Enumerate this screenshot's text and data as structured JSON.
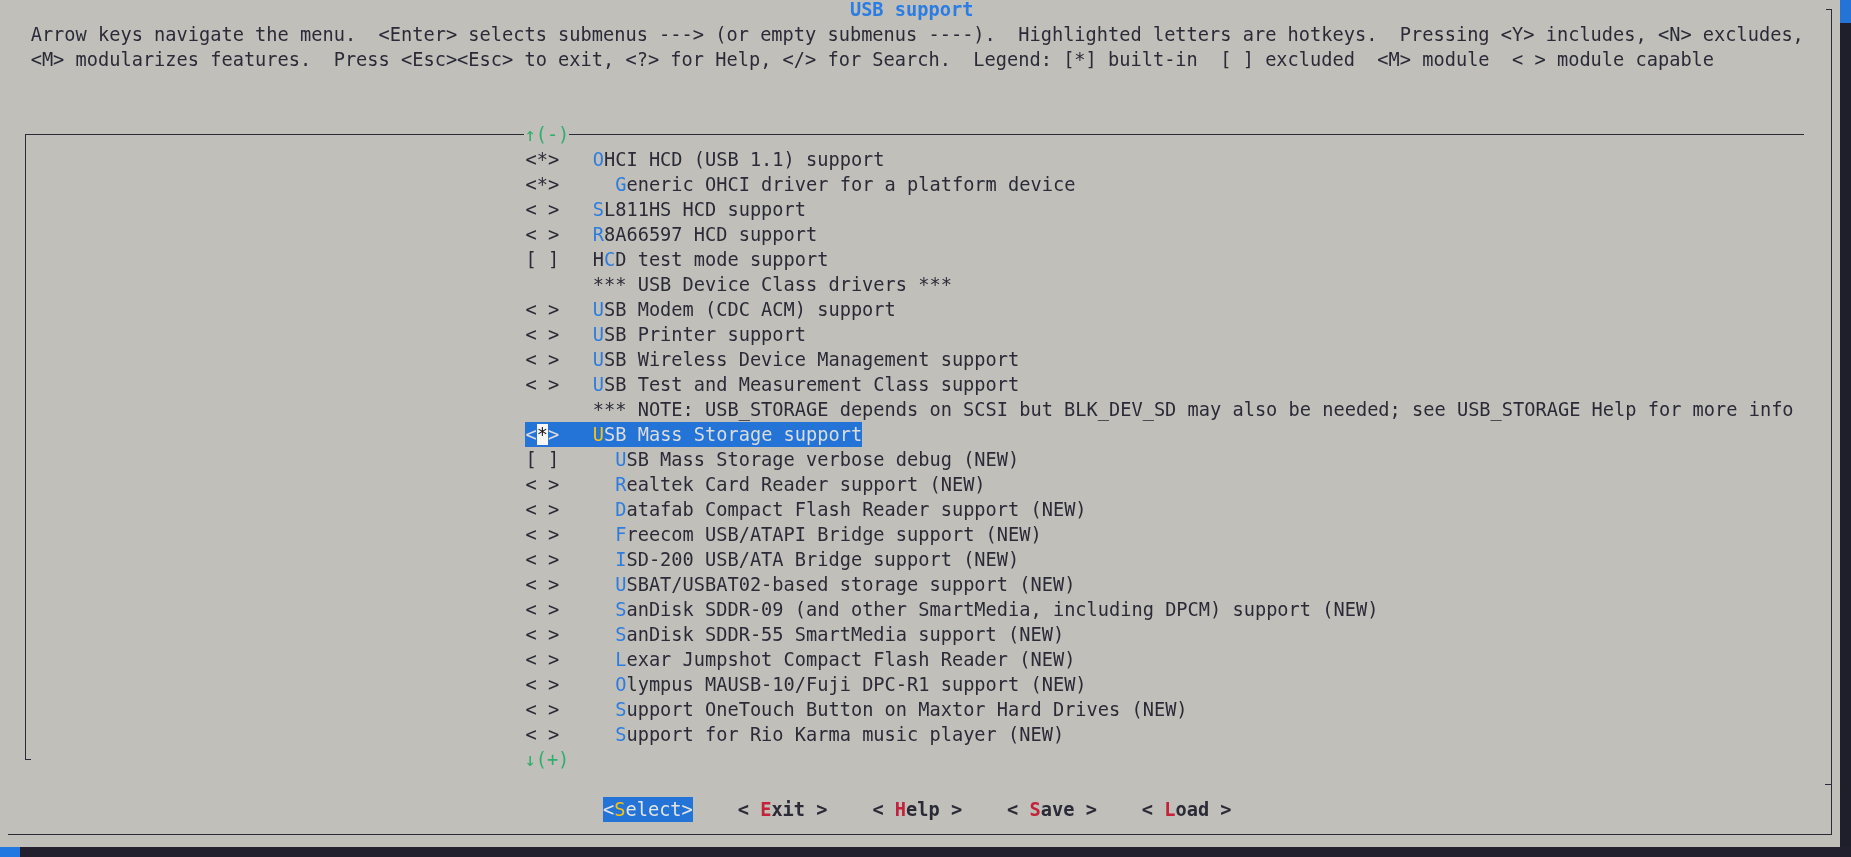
{
  "dialog": {
    "title": "USB support",
    "help_lines": [
      "Arrow keys navigate the menu.  <Enter> selects submenus ---> (or empty submenus ----).  Highlighted letters are hotkeys.  Pressing <Y> includes, <N> excludes,",
      "<M> modularizes features.  Press <Esc><Esc> to exit, <?> for Help, </> for Search.  Legend: [*] built-in  [ ] excluded  <M> module  < > module capable"
    ]
  },
  "menu": {
    "scroll_up": "↑(-)",
    "items": [
      {
        "kind": "option",
        "prompt": "<*>",
        "hotkey": "O",
        "after": "HCI HCD (USB 1.1) support",
        "selected": false,
        "children": [
          {
            "kind": "option",
            "prompt": "<*>",
            "hotkey": "G",
            "after": "eneric OHCI driver for a platform device",
            "selected": false
          }
        ]
      },
      {
        "kind": "option",
        "prompt": "< >",
        "hotkey": "S",
        "after": "L811HS HCD support",
        "selected": false
      },
      {
        "kind": "option",
        "prompt": "< >",
        "hotkey": "R",
        "after": "8A66597 HCD support",
        "selected": false
      },
      {
        "kind": "option",
        "prompt": "[ ]",
        "before": "H",
        "hotkey": "C",
        "after": "D test mode support",
        "selected": false
      },
      {
        "kind": "comment",
        "text": "*** USB Device Class drivers ***",
        "selected": false
      },
      {
        "kind": "option",
        "prompt": "< >",
        "hotkey": "U",
        "after": "SB Modem (CDC ACM) support",
        "selected": false
      },
      {
        "kind": "option",
        "prompt": "< >",
        "hotkey": "U",
        "after": "SB Printer support",
        "selected": false
      },
      {
        "kind": "option",
        "prompt": "< >",
        "hotkey": "U",
        "after": "SB Wireless Device Management support",
        "selected": false
      },
      {
        "kind": "option",
        "prompt": "< >",
        "hotkey": "U",
        "after": "SB Test and Measurement Class support",
        "selected": false
      },
      {
        "kind": "comment",
        "text": "*** NOTE: USB_STORAGE depends on SCSI but BLK_DEV_SD may also be needed; see USB_STORAGE Help for more info",
        "selected": false
      },
      {
        "kind": "option",
        "prompt": "<*>",
        "hotkey": "U",
        "after": "SB Mass Storage support",
        "selected": true,
        "children": [
          {
            "kind": "option",
            "prompt": "[ ]",
            "hotkey": "U",
            "after": "SB Mass Storage verbose debug (NEW)",
            "selected": false
          },
          {
            "kind": "option",
            "prompt": "< >",
            "hotkey": "R",
            "after": "ealtek Card Reader support (NEW)",
            "selected": false
          },
          {
            "kind": "option",
            "prompt": "< >",
            "hotkey": "D",
            "after": "atafab Compact Flash Reader support (NEW)",
            "selected": false
          },
          {
            "kind": "option",
            "prompt": "< >",
            "hotkey": "F",
            "after": "reecom USB/ATAPI Bridge support (NEW)",
            "selected": false
          },
          {
            "kind": "option",
            "prompt": "< >",
            "hotkey": "I",
            "after": "SD-200 USB/ATA Bridge support (NEW)",
            "selected": false
          },
          {
            "kind": "option",
            "prompt": "< >",
            "hotkey": "U",
            "after": "SBAT/USBAT02-based storage support (NEW)",
            "selected": false
          },
          {
            "kind": "option",
            "prompt": "< >",
            "hotkey": "S",
            "after": "anDisk SDDR-09 (and other SmartMedia, including DPCM) support (NEW)",
            "selected": false
          },
          {
            "kind": "option",
            "prompt": "< >",
            "hotkey": "S",
            "after": "anDisk SDDR-55 SmartMedia support (NEW)",
            "selected": false
          },
          {
            "kind": "option",
            "prompt": "< >",
            "hotkey": "L",
            "after": "exar Jumpshot Compact Flash Reader (NEW)",
            "selected": false
          },
          {
            "kind": "option",
            "prompt": "< >",
            "hotkey": "O",
            "after": "lympus MAUSB-10/Fuji DPC-R1 support (NEW)",
            "selected": false
          },
          {
            "kind": "option",
            "prompt": "< >",
            "hotkey": "S",
            "after": "upport OneTouch Button on Maxtor Hard Drives (NEW)",
            "selected": false
          },
          {
            "kind": "option",
            "prompt": "< >",
            "hotkey": "S",
            "after": "upport for Rio Karma music player (NEW)",
            "selected": false
          }
        ]
      }
    ],
    "scroll_down": "↓(+)"
  },
  "buttons": [
    {
      "before": "<",
      "hotkey": "S",
      "after": "elect>",
      "selected": true
    },
    {
      "before": "< ",
      "hotkey": "E",
      "after": "xit >",
      "selected": false
    },
    {
      "before": "< ",
      "hotkey": "H",
      "after": "elp >",
      "selected": false
    },
    {
      "before": "< ",
      "hotkey": "S",
      "after": "ave >",
      "selected": false
    },
    {
      "before": "< ",
      "hotkey": "L",
      "after": "oad >",
      "selected": false
    }
  ]
}
